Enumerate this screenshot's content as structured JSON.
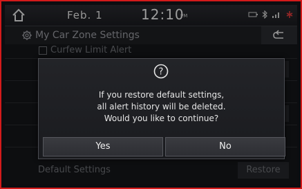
{
  "status": {
    "date": "Feb.  1",
    "time": "12:10",
    "ampm": "PM"
  },
  "titlebar": {
    "title": "My Car Zone Settings",
    "icon": "gear-icon",
    "back_icon": "back-arrow-icon"
  },
  "list": {
    "top_item": "Curfew Limit Alert",
    "default_label": "Default Settings",
    "restore_label": "Restore"
  },
  "dialog": {
    "icon": "question-icon",
    "message_line1": "If you restore default settings,",
    "message_line2": "all alert history will be deleted.",
    "message_line3": "Would you like to continue?",
    "yes_label": "Yes",
    "no_label": "No"
  },
  "colors": {
    "frame": "#d41a1a",
    "background": "#15161a",
    "text": "#e6e6e6"
  }
}
